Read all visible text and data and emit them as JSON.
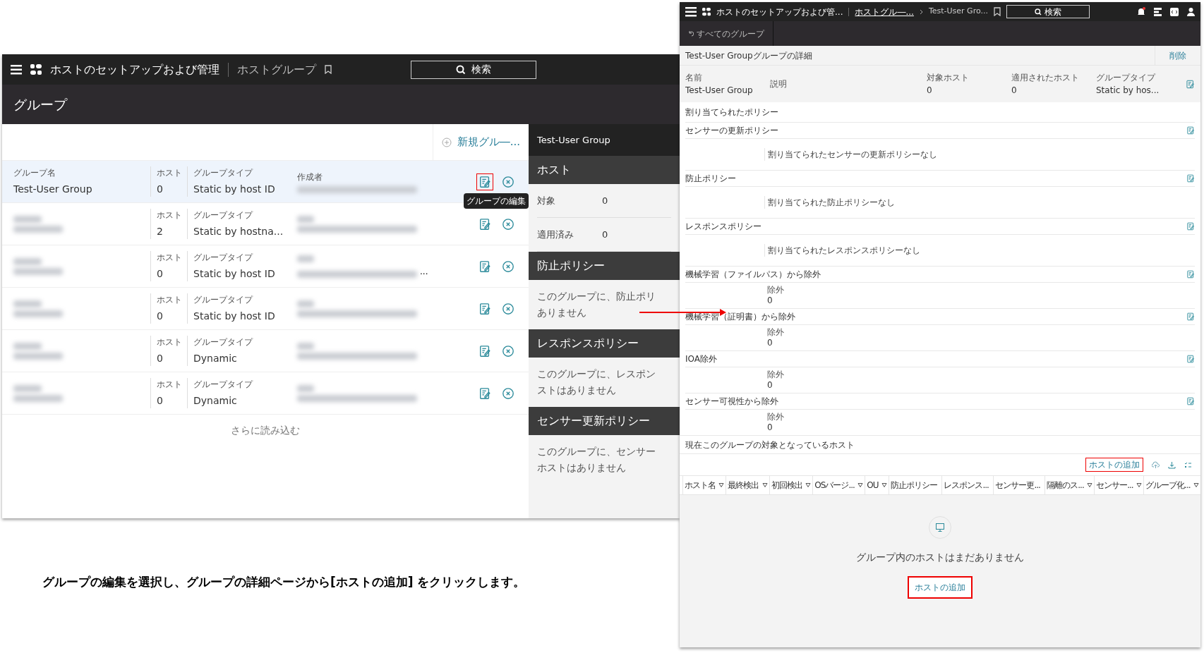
{
  "left_screen": {
    "header": {
      "app_title": "ホストのセットアップおよび管理",
      "breadcrumb": "ホストグループ",
      "search": "検索"
    },
    "page_title": "グループ",
    "new_group_button": "新規グル―...",
    "rows": [
      {
        "name_label": "グループ名",
        "name": "Test-User Group",
        "hosts_label": "ホスト",
        "hosts": "0",
        "type_label": "グループタイプ",
        "type": "Static by host ID",
        "creator_label": "作成者",
        "selected": true,
        "edit_highlighted": true,
        "tooltip": "グループの編集"
      },
      {
        "hosts_label": "ホスト",
        "hosts": "2",
        "type_label": "グループタイプ",
        "type": "Static by hostna...",
        "selected": false,
        "edit_highlighted": false
      },
      {
        "hosts_label": "ホスト",
        "hosts": "0",
        "type_label": "グループタイプ",
        "type": "Static by host ID",
        "creator_suffix": "...",
        "selected": false,
        "edit_highlighted": false
      },
      {
        "hosts_label": "ホスト",
        "hosts": "0",
        "type_label": "グループタイプ",
        "type": "Static by host ID",
        "selected": false,
        "edit_highlighted": false
      },
      {
        "hosts_label": "ホスト",
        "hosts": "0",
        "type_label": "グループタイプ",
        "type": "Dynamic",
        "selected": false,
        "edit_highlighted": false
      },
      {
        "hosts_label": "ホスト",
        "hosts": "0",
        "type_label": "グループタイプ",
        "type": "Dynamic",
        "selected": false,
        "edit_highlighted": false
      }
    ],
    "load_more": "さらに読み込む",
    "side_panel": {
      "title": "Test-User Group",
      "sections": [
        {
          "kind": "stats",
          "heading": "ホスト",
          "items": [
            {
              "label": "対象",
              "value": "0"
            },
            {
              "label": "適用済み",
              "value": "0"
            }
          ]
        },
        {
          "kind": "text",
          "heading": "防止ポリシー",
          "lines": [
            "このグループに、防止ポリ",
            "ありません"
          ]
        },
        {
          "kind": "text",
          "heading": "レスポンスポリシー",
          "lines": [
            "このグループに、レスポン",
            "ストはありません"
          ]
        },
        {
          "kind": "text",
          "heading": "センサー更新ポリシー",
          "lines": [
            "このグループに、センサー",
            "ホストはありません"
          ]
        }
      ]
    }
  },
  "right_screen": {
    "header": {
      "app_title": "ホストのセットアップおよび管...",
      "breadcrumb": "ホストグル―...",
      "breadcrumb_current": "Test-User Gro...",
      "search": "検索"
    },
    "back_link": "すべてのグループ",
    "details_title": "Test-User Groupグループの詳細",
    "delete_button": "削除",
    "fields": [
      {
        "label": "名前",
        "value": "Test-User Group"
      },
      {
        "label": "説明"
      },
      {
        "label": "対象ホスト",
        "value": "0"
      },
      {
        "label": "適用されたホスト",
        "value": "0"
      },
      {
        "label": "グループタイプ",
        "value": "Static by hos..."
      }
    ],
    "assigned_heading": "割り当てられたポリシー",
    "sections": [
      {
        "kind": "text",
        "heading": "センサーの更新ポリシー",
        "text": "割り当てられたセンサーの更新ポリシーなし"
      },
      {
        "kind": "text",
        "heading": "防止ポリシー",
        "text": "割り当てられた防止ポリシーなし"
      },
      {
        "kind": "text",
        "heading": "レスポンスポリシー",
        "text": "割り当てられたレスポンスポリシーなし"
      },
      {
        "kind": "count",
        "heading": "機械学習（ファイルパス）から除外",
        "label": "除外",
        "value": "0"
      },
      {
        "kind": "count",
        "heading": "機械学習（証明書）から除外",
        "label": "除外",
        "value": "0"
      },
      {
        "kind": "count",
        "heading": "IOA除外",
        "label": "除外",
        "value": "0"
      },
      {
        "kind": "count",
        "heading": "センサー可視性から除外",
        "label": "除外",
        "value": "0"
      }
    ],
    "hosts_heading": "現在このグループの対象となっているホスト",
    "add_host_link": "ホストの追加",
    "add_host_link_highlighted": true,
    "columns": [
      {
        "label": "ホスト名",
        "filter": true
      },
      {
        "label": "最終検出",
        "filter": true
      },
      {
        "label": "初回検出",
        "filter": true
      },
      {
        "label": "OSバージ...",
        "filter": true
      },
      {
        "label": "OU",
        "filter": true
      },
      {
        "label": "防止ポリシー",
        "filter": false
      },
      {
        "label": "レスポンス...",
        "filter": false
      },
      {
        "label": "センサー更...",
        "filter": false
      },
      {
        "label": "隔離のス...",
        "filter": true
      },
      {
        "label": "センサー...",
        "filter": true
      },
      {
        "label": "グループ化...",
        "filter": true
      }
    ],
    "empty_message": "グループ内のホストはまだありません",
    "add_host_button": "ホストの追加",
    "add_host_button_highlighted": true
  },
  "caption": "グループの編集を選択し、グループの詳細ページから[ホストの追加]  をクリックします。"
}
